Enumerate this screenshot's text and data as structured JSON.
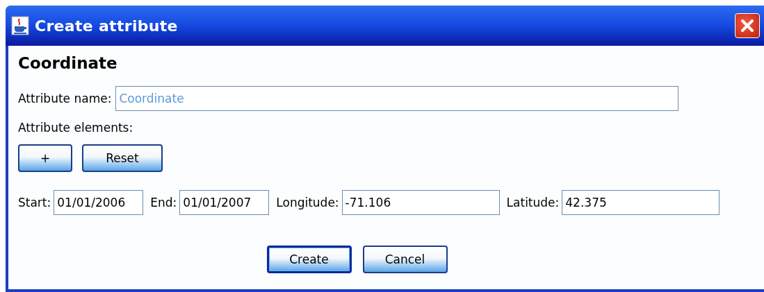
{
  "window": {
    "title": "Create attribute"
  },
  "heading": "Coordinate",
  "name_field": {
    "label": "Attribute name:",
    "value": "Coordinate"
  },
  "elements_label": "Attribute elements:",
  "element_buttons": [
    {
      "label": "+",
      "default": false
    },
    {
      "label": "Reset",
      "default": false
    }
  ],
  "element_fields": [
    {
      "label": "Start:",
      "value": "01/01/2006",
      "kind": "short"
    },
    {
      "label": "End:",
      "value": "01/01/2007",
      "kind": "short"
    },
    {
      "label": "Longitude:",
      "value": "-71.106",
      "kind": "wide"
    },
    {
      "label": "Latitude:",
      "value": "42.375",
      "kind": "wide"
    }
  ],
  "buttons": [
    {
      "label": "Create",
      "default": true
    },
    {
      "label": "Cancel",
      "default": false
    }
  ]
}
